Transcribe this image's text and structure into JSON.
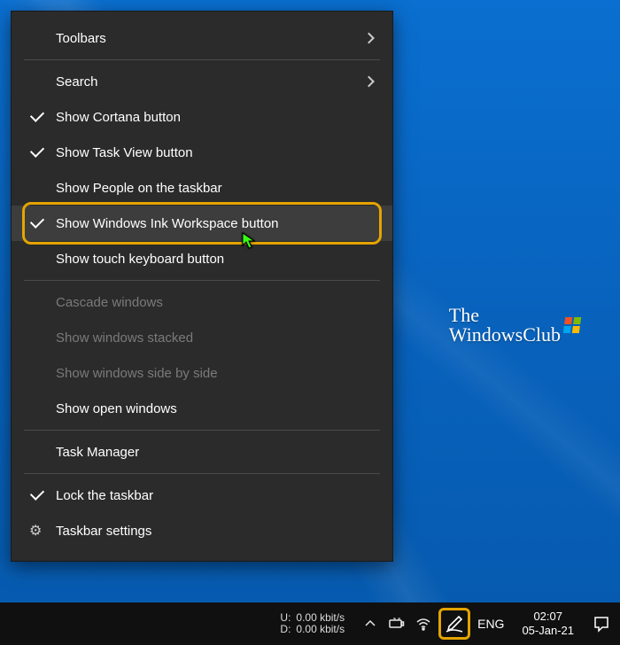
{
  "watermark": {
    "line1": "The",
    "line2": "WindowsClub"
  },
  "context_menu": {
    "toolbars": "Toolbars",
    "search": "Search",
    "show_cortana": "Show Cortana button",
    "show_task_view": "Show Task View button",
    "show_people": "Show People on the taskbar",
    "show_ink": "Show Windows Ink Workspace button",
    "show_touch_kb": "Show touch keyboard button",
    "cascade": "Cascade windows",
    "stacked": "Show windows stacked",
    "side_by_side": "Show windows side by side",
    "open_windows": "Show open windows",
    "task_manager": "Task Manager",
    "lock_taskbar": "Lock the taskbar",
    "taskbar_settings": "Taskbar settings"
  },
  "taskbar": {
    "net": {
      "up_label": "U:",
      "up_value": "0.00 kbit/s",
      "down_label": "D:",
      "down_value": "0.00 kbit/s"
    },
    "lang": "ENG",
    "clock": {
      "time": "02:07",
      "date": "05-Jan-21"
    }
  }
}
